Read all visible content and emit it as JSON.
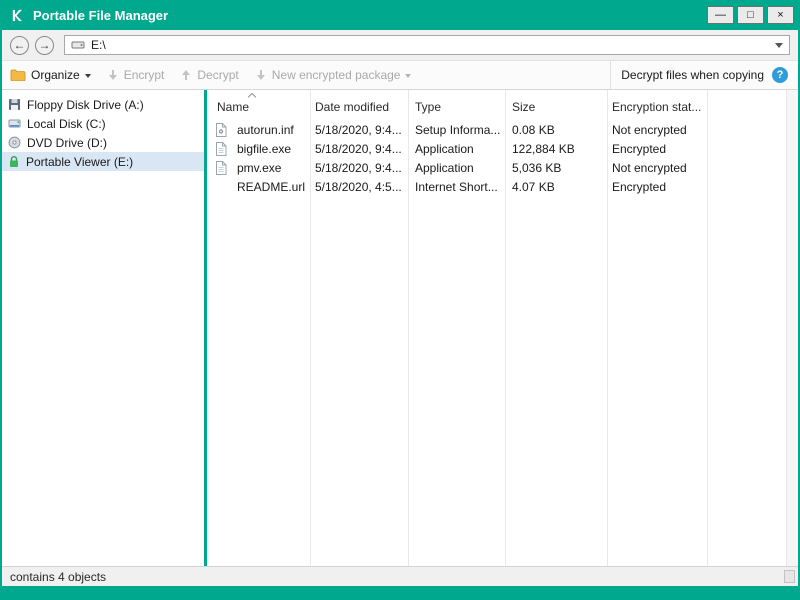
{
  "colors": {
    "brand_teal": "#00a88e",
    "help_blue": "#2f9bdb",
    "lock_green": "#3cb55e",
    "folder_yellow": "#f3b942",
    "selected_row_bg": "#d9e6f3"
  },
  "window": {
    "title": "Portable File Manager",
    "controls": {
      "minimize": "—",
      "maximize": "□",
      "close": "×"
    }
  },
  "navbar": {
    "back_glyph": "←",
    "forward_glyph": "→",
    "address": "E:\\"
  },
  "toolbar": {
    "organize_label": "Organize",
    "encrypt_label": "Encrypt",
    "decrypt_label": "Decrypt",
    "new_package_label": "New encrypted package",
    "decrypt_copy_label": "Decrypt files when copying",
    "help_glyph": "?"
  },
  "sidebar": {
    "items": [
      {
        "label": "Floppy Disk Drive (A:)",
        "icon": "floppy-icon",
        "selected": false
      },
      {
        "label": "Local Disk (C:)",
        "icon": "hard-disk-icon",
        "selected": false
      },
      {
        "label": "DVD Drive (D:)",
        "icon": "dvd-icon",
        "selected": false
      },
      {
        "label": "Portable Viewer (E:)",
        "icon": "lock-icon",
        "selected": true
      }
    ]
  },
  "filelist": {
    "columns": [
      "Name",
      "Date modified",
      "Type",
      "Size",
      "Encryption stat..."
    ],
    "rows": [
      {
        "name": "autorun.inf",
        "date": "5/18/2020, 9:4...",
        "type": "Setup Informa...",
        "size": "0.08 KB",
        "encryption": "Not encrypted",
        "icon": "setup-file-icon"
      },
      {
        "name": "bigfile.exe",
        "date": "5/18/2020, 9:4...",
        "type": "Application",
        "size": "122,884 KB",
        "encryption": "Encrypted",
        "icon": "application-file-icon"
      },
      {
        "name": "pmv.exe",
        "date": "5/18/2020, 9:4...",
        "type": "Application",
        "size": "5,036 KB",
        "encryption": "Not encrypted",
        "icon": "application-file-icon"
      },
      {
        "name": "README.url",
        "date": "5/18/2020, 4:5...",
        "type": "Internet Short...",
        "size": "4.07 KB",
        "encryption": "Encrypted",
        "icon": "none"
      }
    ]
  },
  "statusbar": {
    "text": "contains 4 objects"
  }
}
